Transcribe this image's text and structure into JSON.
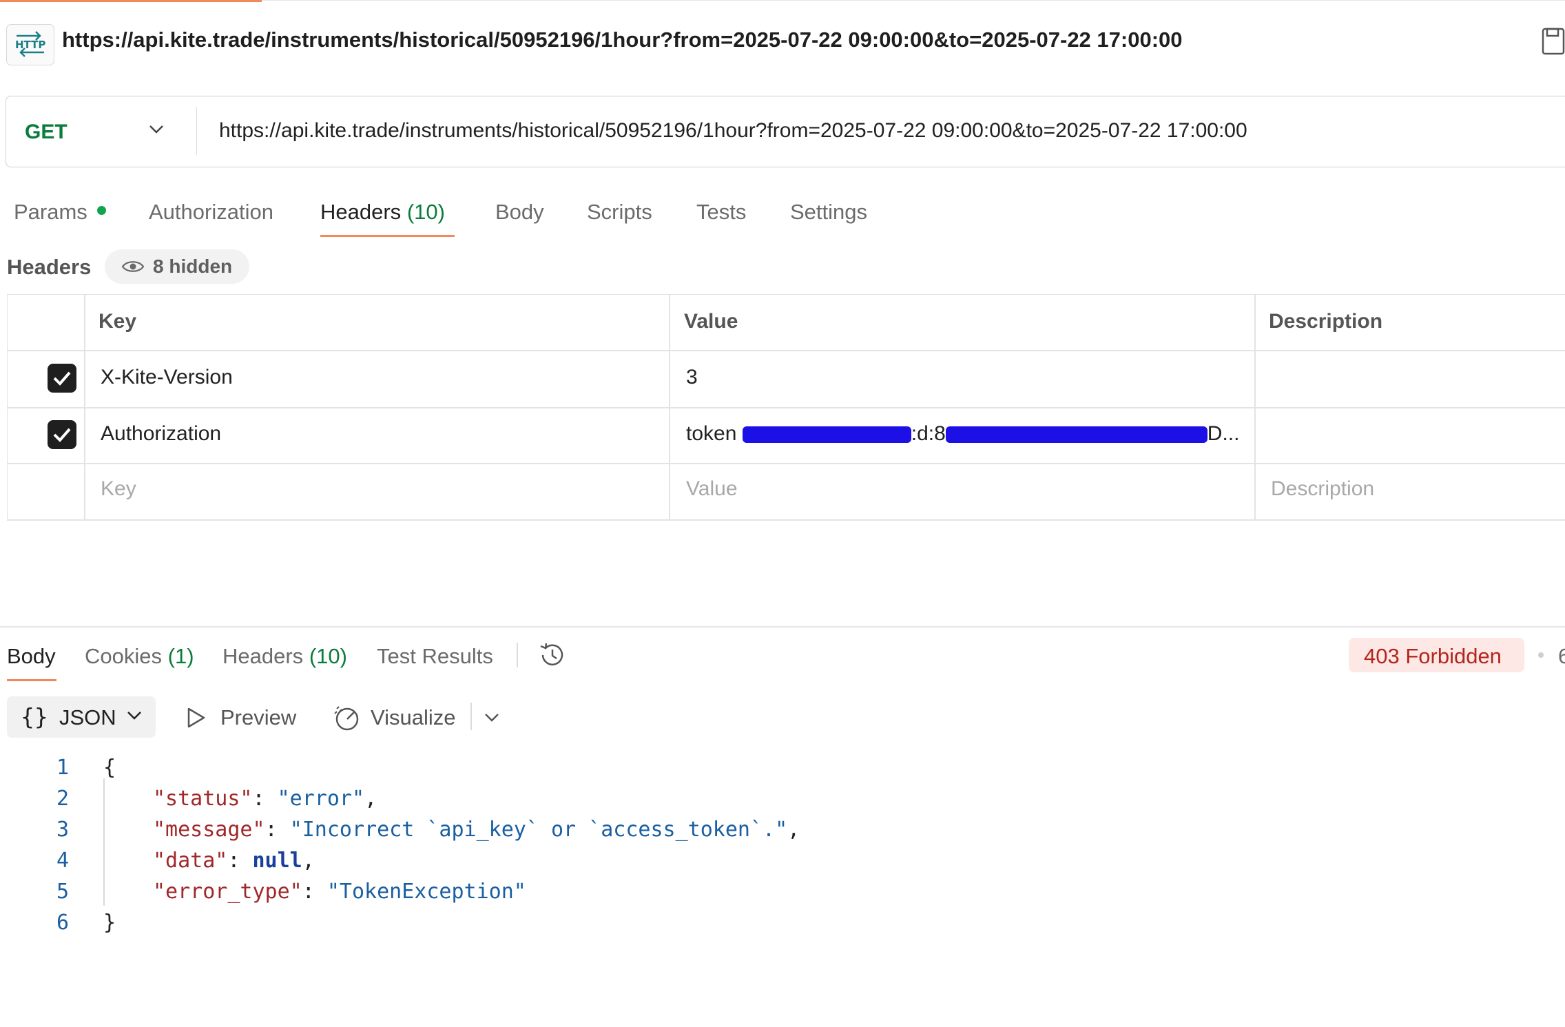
{
  "request": {
    "title": "https://api.kite.trade/instruments/historical/50952196/1hour?from=2025-07-22 09:00:00&to=2025-07-22 17:00:00",
    "icon": "http-icon",
    "method": "GET",
    "url": "https://api.kite.trade/instruments/historical/50952196/1hour?from=2025-07-22 09:00:00&to=2025-07-22 17:00:00"
  },
  "request_tabs": [
    {
      "label": "Params",
      "count": ""
    },
    {
      "label": "Authorization",
      "count": ""
    },
    {
      "label": "Headers",
      "count": "(10)"
    },
    {
      "label": "Body",
      "count": ""
    },
    {
      "label": "Scripts",
      "count": ""
    },
    {
      "label": "Tests",
      "count": ""
    },
    {
      "label": "Settings",
      "count": ""
    }
  ],
  "active_request_tab": "Headers",
  "headers_section": {
    "label": "Headers",
    "hidden_label": "8 hidden"
  },
  "headers_table": {
    "columns": [
      "Key",
      "Value",
      "Description"
    ],
    "rows": [
      {
        "checked": true,
        "key": "X-Kite-Version",
        "value": "3",
        "description": ""
      },
      {
        "checked": true,
        "key": "Authorization",
        "value_prefix": "token ",
        "value_mid": ":d:8",
        "value_suffix": "D...",
        "description": ""
      }
    ],
    "placeholders": {
      "key": "Key",
      "value": "Value",
      "description": "Description"
    }
  },
  "response_tabs": [
    {
      "label": "Body",
      "count": ""
    },
    {
      "label": "Cookies",
      "count": "(1)"
    },
    {
      "label": "Headers",
      "count": "(10)"
    },
    {
      "label": "Test Results",
      "count": ""
    }
  ],
  "active_response_tab": "Body",
  "status": {
    "text": "403 Forbidden",
    "color": "#b3261e",
    "trailing": "6"
  },
  "response_toolbar": {
    "format": "JSON",
    "preview": "Preview",
    "visualize": "Visualize"
  },
  "response_body": {
    "line_numbers": [
      "1",
      "2",
      "3",
      "4",
      "5",
      "6"
    ],
    "open_brace": "{",
    "close_brace": "}",
    "lines": [
      {
        "key": "\"status\"",
        "sep": ": ",
        "value": "\"error\"",
        "tail": ","
      },
      {
        "key": "\"message\"",
        "sep": ": ",
        "value": "\"Incorrect `api_key` or `access_token`.\"",
        "tail": ","
      },
      {
        "key": "\"data\"",
        "sep": ": ",
        "value": "null",
        "tail": ","
      },
      {
        "key": "\"error_type\"",
        "sep": ": ",
        "value": "\"TokenException\"",
        "tail": ""
      }
    ]
  },
  "colors": {
    "accent": "#f08a5d",
    "get_method": "#0a7c3b",
    "count_green": "#0a7c3b",
    "redaction": "#1d10e6"
  }
}
